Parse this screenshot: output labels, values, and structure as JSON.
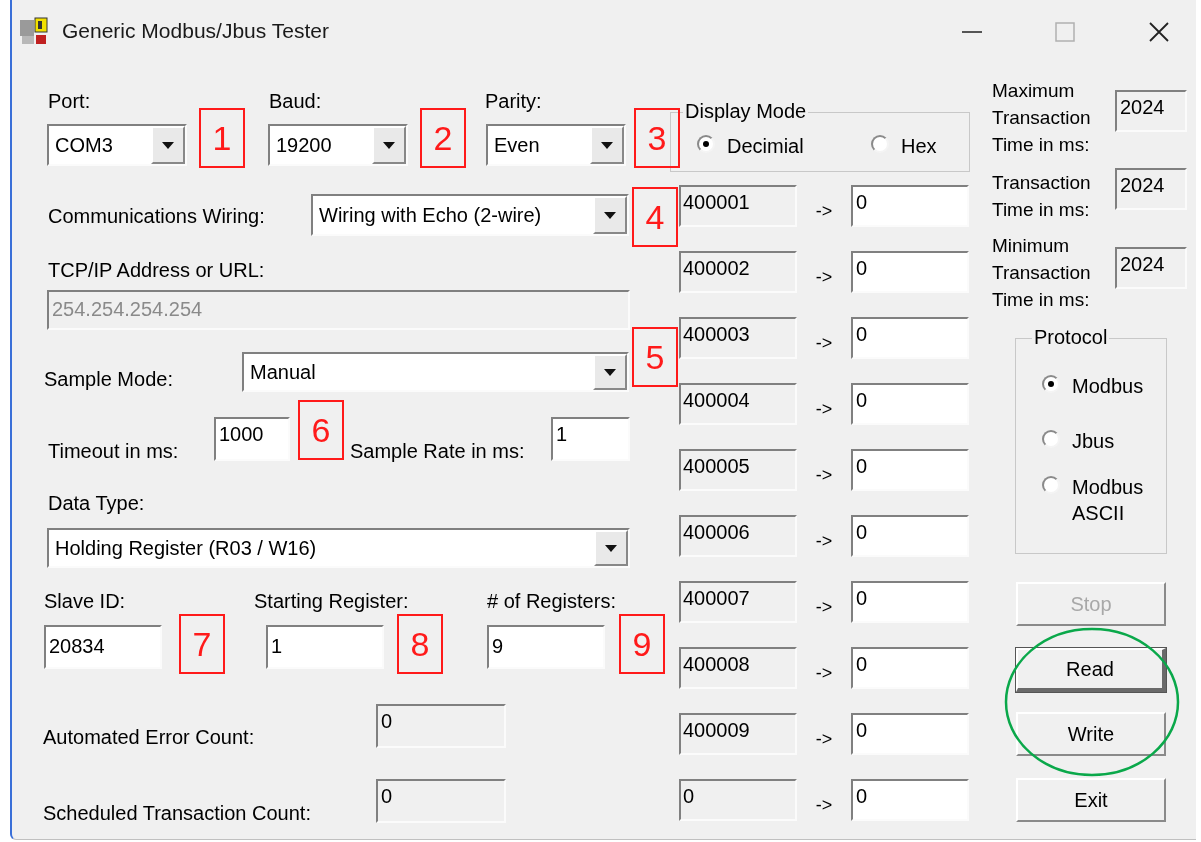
{
  "window": {
    "title": "Generic Modbus/Jbus Tester"
  },
  "port": {
    "label": "Port:",
    "value": "COM3"
  },
  "baud": {
    "label": "Baud:",
    "value": "19200"
  },
  "parity": {
    "label": "Parity:",
    "value": "Even"
  },
  "display_mode": {
    "title": "Display Mode",
    "options": [
      {
        "label": "Decimial",
        "selected": true
      },
      {
        "label": "Hex",
        "selected": false
      }
    ]
  },
  "wiring": {
    "label": "Communications Wiring:",
    "value": "Wiring with Echo (2-wire)"
  },
  "tcp_ip": {
    "label": "TCP/IP Address or URL:",
    "value": "254.254.254.254",
    "disabled": true
  },
  "sample_mode": {
    "label": "Sample Mode:",
    "value": "Manual"
  },
  "timeout": {
    "label": "Timeout in ms:",
    "value": "1000"
  },
  "sample_rate": {
    "label": "Sample Rate in ms:",
    "value": "1"
  },
  "data_type": {
    "label": "Data Type:",
    "value": "Holding Register (R03 / W16)"
  },
  "slave_id": {
    "label": "Slave ID:",
    "value": "20834"
  },
  "starting_register": {
    "label": "Starting Register:",
    "value": "1"
  },
  "num_registers": {
    "label": "# of Registers:",
    "value": "9"
  },
  "error_count": {
    "label": "Automated Error Count:",
    "value": "0"
  },
  "transaction_count": {
    "label": "Scheduled Transaction Count:",
    "value": "0"
  },
  "registers": [
    {
      "address": "400001",
      "arrow": "->",
      "value": "0"
    },
    {
      "address": "400002",
      "arrow": "->",
      "value": "0"
    },
    {
      "address": "400003",
      "arrow": "->",
      "value": "0"
    },
    {
      "address": "400004",
      "arrow": "->",
      "value": "0"
    },
    {
      "address": "400005",
      "arrow": "->",
      "value": "0"
    },
    {
      "address": "400006",
      "arrow": "->",
      "value": "0"
    },
    {
      "address": "400007",
      "arrow": "->",
      "value": "0"
    },
    {
      "address": "400008",
      "arrow": "->",
      "value": "0"
    },
    {
      "address": "400009",
      "arrow": "->",
      "value": "0"
    },
    {
      "address": "0",
      "arrow": "->",
      "value": "0"
    }
  ],
  "timing": [
    {
      "label": "Maximum Transaction Time in ms:",
      "value": "2024"
    },
    {
      "label": "Transaction Time in ms:",
      "value": "2024"
    },
    {
      "label": "Minimum Transaction Time in ms:",
      "value": "2024"
    }
  ],
  "protocol": {
    "title": "Protocol",
    "options": [
      {
        "label": "Modbus",
        "selected": true
      },
      {
        "label": "Jbus",
        "selected": false
      },
      {
        "label": "Modbus ASCII",
        "selected": false
      }
    ]
  },
  "buttons": [
    {
      "label": "Stop",
      "disabled": true,
      "default": false
    },
    {
      "label": "Read",
      "disabled": false,
      "default": true
    },
    {
      "label": "Write",
      "disabled": false,
      "default": false
    },
    {
      "label": "Exit",
      "disabled": false,
      "default": false
    }
  ],
  "annotations": [
    {
      "kind": "number",
      "label": "1"
    },
    {
      "kind": "number",
      "label": "2"
    },
    {
      "kind": "number",
      "label": "3"
    },
    {
      "kind": "number",
      "label": "4"
    },
    {
      "kind": "number",
      "label": "5"
    },
    {
      "kind": "number",
      "label": "6"
    },
    {
      "kind": "number",
      "label": "7"
    },
    {
      "kind": "number",
      "label": "8"
    },
    {
      "kind": "number",
      "label": "9"
    },
    {
      "kind": "ellipse"
    }
  ]
}
